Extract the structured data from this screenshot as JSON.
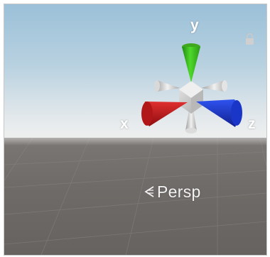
{
  "scene_view": {
    "camera_mode_label": "Persp",
    "gizmo": {
      "x_label": "x",
      "y_label": "y",
      "z_label": "z",
      "colors": {
        "x": "#c8191c",
        "y": "#3cc21e",
        "z": "#1e3cd8",
        "neutral": "#d6d6d6"
      }
    },
    "icons": {
      "lock": "lock-icon",
      "persp": "chevron-left-icon"
    }
  }
}
